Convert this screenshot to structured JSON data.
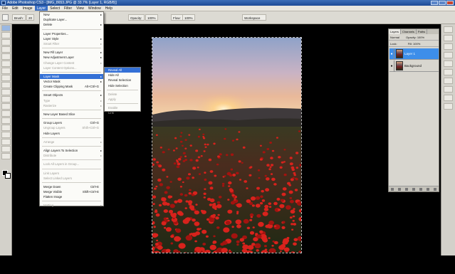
{
  "window": {
    "title": "Adobe Photoshop CS3 - [IMG_8653.JPG @ 33.7% (Layer 1, RGB/8)]"
  },
  "menubar": {
    "items": [
      "File",
      "Edit",
      "Image",
      "Layer",
      "Select",
      "Filter",
      "View",
      "Window",
      "Help"
    ],
    "active": "Layer"
  },
  "options": {
    "brush_label": "Brush:",
    "brush_size": "20",
    "mode_label": "Mode:",
    "mode_value": "Normal",
    "opacity_label": "Opacity:",
    "opacity_value": "100%",
    "flow_label": "Flow:",
    "flow_value": "100%",
    "workspace_label": "Workspace"
  },
  "layer_menu": {
    "items": [
      {
        "label": "New",
        "arrow": true
      },
      {
        "label": "Duplicate Layer...",
        "arrow": false
      },
      {
        "label": "Delete",
        "arrow": true
      },
      {
        "sep": true
      },
      {
        "label": "Layer Properties...",
        "arrow": false
      },
      {
        "label": "Layer Style",
        "arrow": true
      },
      {
        "label": "Smart Filter",
        "arrow": true,
        "disabled": true
      },
      {
        "sep": true
      },
      {
        "label": "New Fill Layer",
        "arrow": true
      },
      {
        "label": "New Adjustment Layer",
        "arrow": true
      },
      {
        "label": "Change Layer Content",
        "arrow": true,
        "disabled": true
      },
      {
        "label": "Layer Content Options...",
        "arrow": false,
        "disabled": true
      },
      {
        "sep": true
      },
      {
        "label": "Layer Mask",
        "arrow": true,
        "highlight": true
      },
      {
        "label": "Vector Mask",
        "arrow": true
      },
      {
        "label": "Create Clipping Mask",
        "shortcut": "Alt+Ctrl+G"
      },
      {
        "sep": true
      },
      {
        "label": "Smart Objects",
        "arrow": true
      },
      {
        "label": "Type",
        "arrow": true,
        "disabled": true
      },
      {
        "label": "Rasterize",
        "arrow": true,
        "disabled": true
      },
      {
        "sep": true
      },
      {
        "label": "New Layer Based Slice",
        "arrow": false
      },
      {
        "sep": true
      },
      {
        "label": "Group Layers",
        "shortcut": "Ctrl+G"
      },
      {
        "label": "Ungroup Layers",
        "shortcut": "Shift+Ctrl+G",
        "disabled": true
      },
      {
        "label": "Hide Layers",
        "arrow": false
      },
      {
        "sep": true
      },
      {
        "label": "Arrange",
        "arrow": true,
        "disabled": true
      },
      {
        "sep": true
      },
      {
        "label": "Align Layers To Selection",
        "arrow": true
      },
      {
        "label": "Distribute",
        "arrow": true,
        "disabled": true
      },
      {
        "sep": true
      },
      {
        "label": "Lock All Layers in Group...",
        "arrow": false,
        "disabled": true
      },
      {
        "sep": true
      },
      {
        "label": "Link Layers",
        "arrow": false,
        "disabled": true
      },
      {
        "label": "Select Linked Layers",
        "arrow": false,
        "disabled": true
      },
      {
        "sep": true
      },
      {
        "label": "Merge Down",
        "shortcut": "Ctrl+E"
      },
      {
        "label": "Merge Visible",
        "shortcut": "Shift+Ctrl+E"
      },
      {
        "label": "Flatten Image",
        "arrow": false
      },
      {
        "sep": true
      },
      {
        "label": "Matting",
        "arrow": true,
        "disabled": true
      }
    ]
  },
  "layer_mask_submenu": {
    "items": [
      {
        "label": "Reveal All",
        "highlight": true
      },
      {
        "label": "Hide All"
      },
      {
        "label": "Reveal Selection"
      },
      {
        "label": "Hide Selection"
      },
      {
        "sep": true
      },
      {
        "label": "Delete",
        "disabled": true
      },
      {
        "label": "Apply",
        "disabled": true
      },
      {
        "sep": true
      },
      {
        "label": "Enable",
        "disabled": true
      },
      {
        "label": "Link",
        "disabled": true
      }
    ]
  },
  "layers_panel": {
    "tabs": [
      "Layers",
      "Channels",
      "Paths"
    ],
    "blend_mode": "Normal",
    "opacity_label": "Opacity:",
    "opacity_value": "100%",
    "lock_label": "Lock:",
    "fill_label": "Fill:",
    "fill_value": "100%",
    "layers": [
      {
        "name": "Layer 1",
        "selected": true
      },
      {
        "name": "Background",
        "selected": false
      }
    ]
  }
}
